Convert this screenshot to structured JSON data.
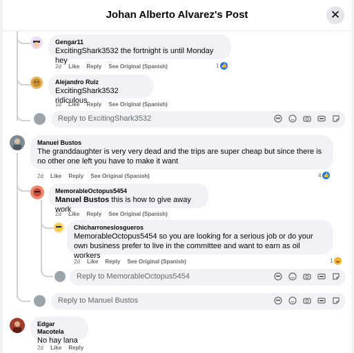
{
  "header": {
    "title": "Johan Alberto Alvarez's Post",
    "close_icon": "✕"
  },
  "comments": [
    {
      "author": "Gengar11",
      "text": "ExcitingShark3532 the fortnight is until Monday hey",
      "time": "2d",
      "like": "Like",
      "reply": "Reply",
      "see_original": "See Original (Spanish)",
      "reaction_count": "1"
    },
    {
      "author": "Alejandro Ruiz",
      "text": "ExcitingShark3532 ridiculous",
      "time": "1d",
      "like": "Like",
      "reply": "Reply",
      "see_original": "See Original (Spanish)"
    },
    {
      "author": "Manuel Bustos",
      "text": "The granddaughter is very very dead and the trips are super cheap but since there is no other one left you have to make it want",
      "time": "2d",
      "like": "Like",
      "reply": "Reply",
      "see_original": "See Original (Spanish)",
      "reaction_count": "4"
    },
    {
      "author": "MemorableOctopus5454",
      "mention": "Manuel Bustos",
      "text": " this is how to give away work",
      "time": "2d",
      "like": "Like",
      "reply": "Reply",
      "see_original": "See Original (Spanish)"
    },
    {
      "author": "Chicharroneslosgueros",
      "text": "MemorableOctopus5454 so you are looking for a serious job or do your own business prefer to live in the committee and want to earn as oil workers",
      "time": "2d",
      "like": "Like",
      "reply": "Reply",
      "see_original": "See Original (Spanish)",
      "reaction_count": "1"
    },
    {
      "author": "Edgar Macotela",
      "text": "No hay lana",
      "time": "2d",
      "like": "Like",
      "reply": "Reply"
    }
  ],
  "reply_boxes": {
    "shark": "Reply to ExcitingShark3532",
    "octopus": "Reply to MemorableOctopus5454",
    "manuel": "Reply to Manuel Bustos"
  },
  "icons": [
    "avatar-sticker-icon",
    "emoji-icon",
    "camera-icon",
    "gif-icon",
    "sticker-icon",
    "like-icon",
    "haha-icon",
    "close-icon"
  ],
  "colors": {
    "like_blue": "#1877f2",
    "bubble_gray": "#f0f2f5",
    "meta_gray": "#65676b",
    "haha_yellow": "#f7b125"
  }
}
